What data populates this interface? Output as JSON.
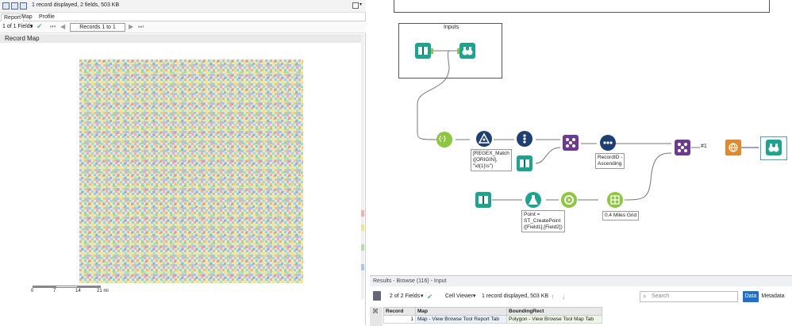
{
  "browse_window": {
    "status": "1 record displayed, 2 fields, 503 KB",
    "tabs": [
      "Report",
      "Map",
      "Profile"
    ],
    "fields_selector": "1 of 1 Fields",
    "records_range": "Records 1 to 1",
    "report_title": "Record Map",
    "record_number": "1",
    "scale_labels": [
      "0",
      "7",
      "14",
      "21 mi"
    ]
  },
  "canvas": {
    "container_title": "Inputs",
    "labels": {
      "regex": "[REGEX_Match\n([ORIGIN],\n\"\\d{1}\\s\")",
      "recordid": "RecordID -\nAscending",
      "createpoint": "Point =\nST_CreatePoint\n([Field1],[Field2])",
      "grid": "0.4 Miles Grid",
      "join_label": "#1"
    }
  },
  "results": {
    "header": "Results - Browse (116) - Input",
    "fields_selector": "2 of 2 Fields",
    "cell_viewer": "Cell Viewer",
    "status": "1 record displayed, 503 KB",
    "search_placeholder": "Search",
    "data_tab": "Data",
    "metadata_tab": "Metadata",
    "columns": [
      "Record",
      "Map",
      "BoundingRect"
    ],
    "rows": [
      {
        "record": "1",
        "map": "Map - View Browse Tool Report Tab",
        "bounding": "Polygon - View Browse Tool Map Tab"
      }
    ]
  },
  "colors": {
    "tool_teal": "#1aa58f",
    "tool_navy": "#1d3f73",
    "tool_purple": "#6b3b8f",
    "tool_green": "#8dc63f",
    "tool_orange": "#e08a2c",
    "accent_blue": "#1f6fd1"
  }
}
